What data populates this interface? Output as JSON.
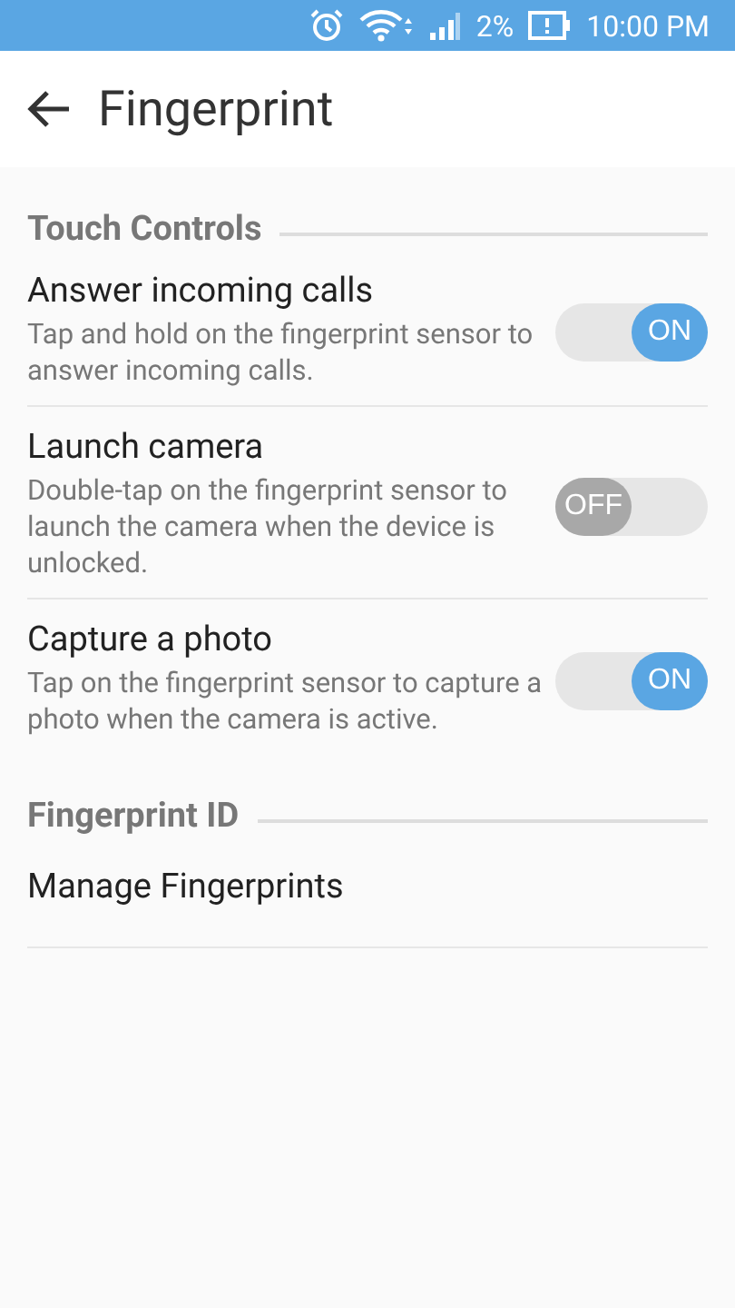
{
  "status_bar": {
    "battery": "2%",
    "time": "10:00 PM"
  },
  "app_bar": {
    "title": "Fingerprint"
  },
  "sections": [
    {
      "title": "Touch Controls",
      "items": [
        {
          "kind": "toggle",
          "title": "Answer incoming calls",
          "description": "Tap and hold on the fingerprint sensor to answer incoming calls.",
          "on": true,
          "toggle_label": "ON"
        },
        {
          "kind": "toggle",
          "title": "Launch camera",
          "description": "Double-tap on the fingerprint sensor to launch the camera when the device is unlocked.",
          "on": false,
          "toggle_label": "OFF"
        },
        {
          "kind": "toggle",
          "title": "Capture a photo",
          "description": "Tap on the fingerprint sensor to capture a photo when the camera is active.",
          "on": true,
          "toggle_label": "ON"
        }
      ]
    },
    {
      "title": "Fingerprint ID",
      "items": [
        {
          "kind": "link",
          "title": "Manage Fingerprints"
        }
      ]
    }
  ]
}
